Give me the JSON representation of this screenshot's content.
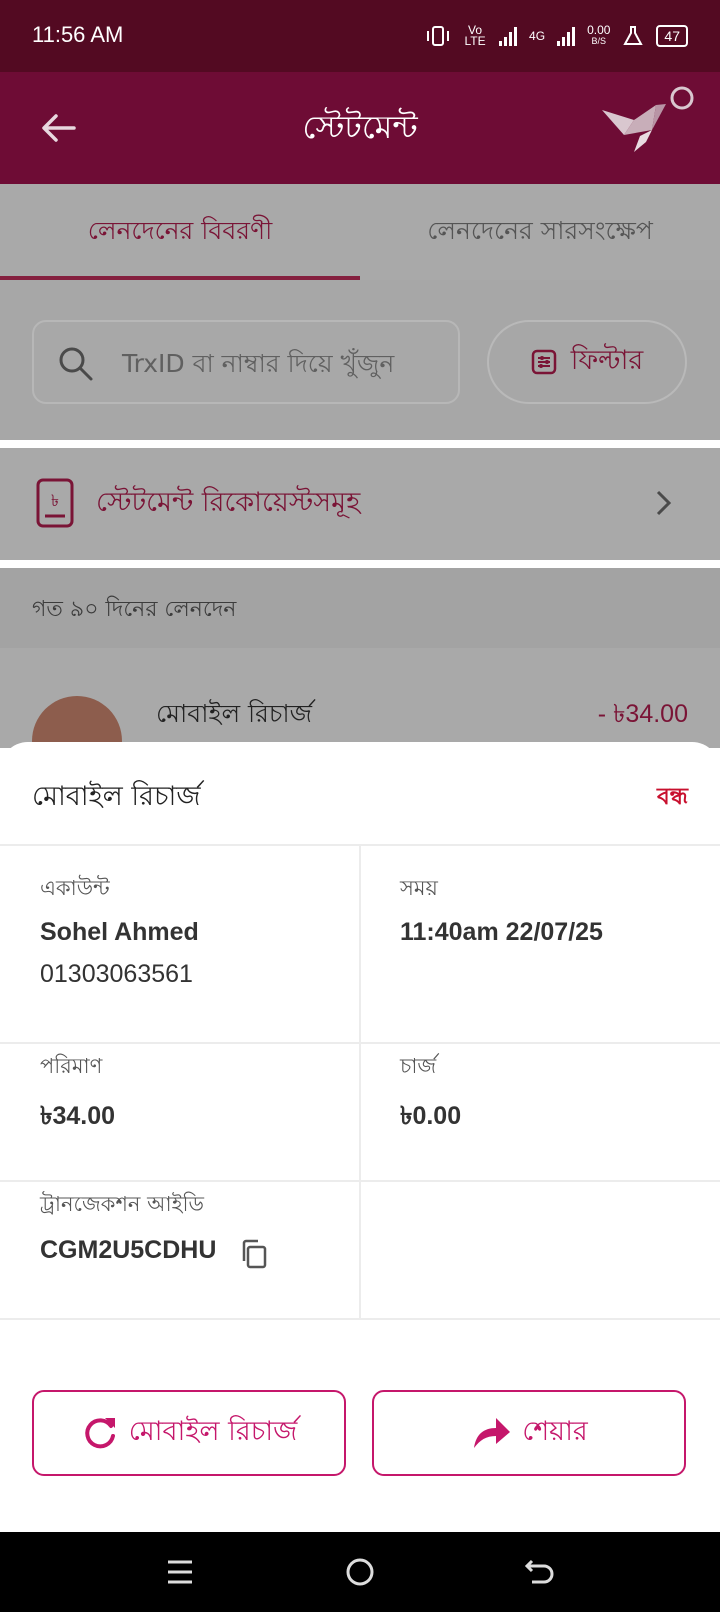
{
  "status_bar": {
    "time": "11:56 AM",
    "volte": "Vo LTE",
    "network": "4G",
    "speed": "0.00",
    "speed_unit": "B/S",
    "battery": "47"
  },
  "app_bar": {
    "title": "স্টেটমেন্ট",
    "back_icon": "arrow-left-icon",
    "logo_icon": "origami-bird-logo"
  },
  "tabs": [
    {
      "label": "লেনদেনের বিবরণী",
      "active": true
    },
    {
      "label": "লেনদেনের সারসংক্ষেপ",
      "active": false
    }
  ],
  "search": {
    "placeholder": "TrxID বা নাম্বার দিয়ে খুঁজুন",
    "filter_label": "ফিল্টার"
  },
  "statement_requests": {
    "label": "স্টেটমেন্ট রিকোয়েস্টসমূহ"
  },
  "history": {
    "label": "গত ৯০ দিনের লেনদেন",
    "transaction": {
      "title": "মোবাইল রিচার্জ",
      "amount": "- ৳34.00"
    }
  },
  "sheet": {
    "title": "মোবাইল রিচার্জ",
    "close_label": "বন্ধ",
    "account_label": "একাউন্ট",
    "account_name": "Sohel Ahmed",
    "account_number": "01303063561",
    "time_label": "সময়",
    "time_value": "11:40am 22/07/25",
    "amount_label": "পরিমাণ",
    "amount_value": "৳34.00",
    "charge_label": "চার্জ",
    "charge_value": "৳0.00",
    "txn_id_label": "ট্রানজেকশন আইডি",
    "txn_id_value": "CGM2U5CDHU",
    "recharge_button": "মোবাইল রিচার্জ",
    "share_button": "শেয়ার"
  },
  "colors": {
    "status_bar": "#530a22",
    "app_bar": "#6e0c35",
    "accent": "#c5176b",
    "close": "#c8102e"
  }
}
